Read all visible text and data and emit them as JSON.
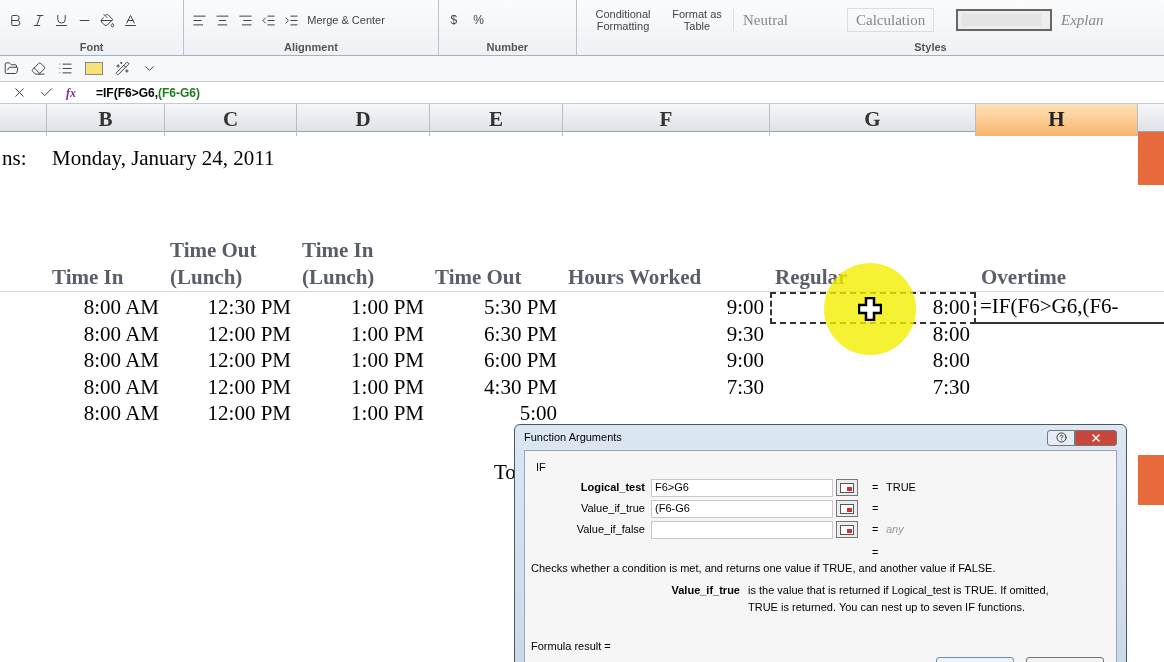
{
  "ribbon": {
    "groups": [
      {
        "label": "Font"
      },
      {
        "label": "Alignment"
      },
      {
        "label": "Number"
      },
      {
        "label": "Styles"
      }
    ],
    "merge_button": "Merge & Center",
    "currency_button": "$",
    "percent_button": "%",
    "conditional_formatting": "Conditional Formatting",
    "format_as_table": "Format as Table",
    "cell_styles": [
      {
        "label": "Neutral",
        "kind": "plain",
        "selected": false
      },
      {
        "label": "Calculation",
        "kind": "boxed",
        "selected": false
      },
      {
        "kind": "check",
        "selected": true
      },
      {
        "label": "Explan",
        "kind": "italic",
        "selected": false
      }
    ]
  },
  "formula_bar": {
    "function_label": "fx",
    "formula": "=IF(F6>G6,",
    "highlighted_argument": "(F6-G6)"
  },
  "columns": [
    {
      "label": "B",
      "selected": false
    },
    {
      "label": "C",
      "selected": false
    },
    {
      "label": "D",
      "selected": false
    },
    {
      "label": "E",
      "selected": false
    },
    {
      "label": "F",
      "selected": false
    },
    {
      "label": "G",
      "selected": false
    },
    {
      "label": "H",
      "selected": true
    }
  ],
  "sheet": {
    "label_fragment": "ns:",
    "date": "Monday, January 24, 2011",
    "headers": [
      {
        "lines": [
          "Time In"
        ]
      },
      {
        "lines": [
          "Time Out",
          "(Lunch)"
        ]
      },
      {
        "lines": [
          "Time In",
          "(Lunch)"
        ]
      },
      {
        "lines": [
          "Time Out"
        ]
      },
      {
        "lines": [
          "Hours Worked"
        ]
      },
      {
        "lines": [
          "Regular"
        ]
      },
      {
        "lines": [
          "Overtime"
        ]
      }
    ],
    "rows": [
      {
        "cells": [
          "8:00 AM",
          "12:30 PM",
          "1:00 PM",
          "5:30 PM",
          "9:00",
          "8:00"
        ],
        "overtime": "=IF(F6>G6,(F6-",
        "marquee": true,
        "editing": true
      },
      {
        "cells": [
          "8:00 AM",
          "12:00 PM",
          "1:00 PM",
          "6:30 PM",
          "9:30",
          "8:00"
        ],
        "marquee": false,
        "editing": false
      },
      {
        "cells": [
          "8:00 AM",
          "12:00 PM",
          "1:00 PM",
          "6:00 PM",
          "9:00",
          "8:00"
        ],
        "marquee": false,
        "editing": false
      },
      {
        "cells": [
          "8:00 AM",
          "12:00 PM",
          "1:00 PM",
          "4:30 PM",
          "7:30",
          "7:30"
        ],
        "marquee": false,
        "editing": false
      },
      {
        "cells": [
          "8:00 AM",
          "12:00 PM",
          "1:00 PM",
          "5:00"
        ],
        "marquee": false,
        "editing": false
      }
    ],
    "total_fragment": "To"
  },
  "dialog": {
    "title": "Function Arguments",
    "function": "IF",
    "arguments": [
      {
        "name": "Logical_test",
        "required": true,
        "value": "F6>G6",
        "equals": "=",
        "result": "TRUE",
        "result_is_type": false
      },
      {
        "name": "Value_if_true",
        "required": false,
        "value": "(F6-G6",
        "equals": "="
      },
      {
        "name": "Value_if_false",
        "required": false,
        "equals": "=",
        "result": "any",
        "result_is_type": true
      }
    ],
    "result_line": "=",
    "description": "Checks whether a condition is met, and returns one value if TRUE, and another value if FALSE.",
    "argument_help": {
      "name": "Value_if_true",
      "text": "is the value that is returned if Logical_test is TRUE. If omitted, TRUE is returned. You can nest up to seven IF functions."
    },
    "formula_result": "Formula result ="
  }
}
